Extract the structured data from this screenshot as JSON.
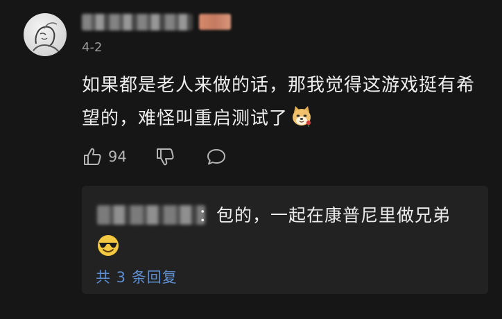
{
  "comment": {
    "date": "4-2",
    "text": "如果都是老人来做的话，那我觉得这游戏挺有希望的，难怪叫重启测试了",
    "like_count": "94"
  },
  "reply": {
    "text": "：包的，一起在康普尼里做兄弟",
    "more_replies_label": "共 3 条回复"
  },
  "icons": {
    "like": "thumbs-up-icon",
    "dislike": "thumbs-down-icon",
    "comment": "comment-bubble-icon",
    "emoji_1": "doge-emoji",
    "emoji_2": "sunglasses-emoji"
  },
  "colors": {
    "background": "#161616",
    "reply_background": "#222222",
    "link": "#5f8fd0"
  }
}
